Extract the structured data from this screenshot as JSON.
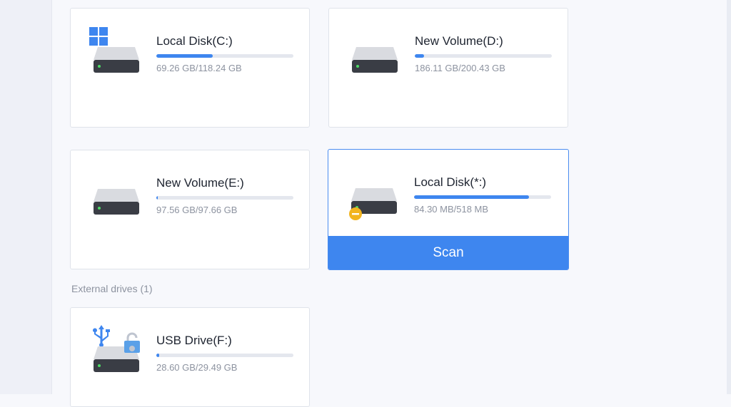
{
  "colors": {
    "accent": "#3e86ef",
    "warning": "#f2b41f"
  },
  "drives": [
    {
      "name": "Local Disk(C:)",
      "size": "69.26 GB/118.24 GB",
      "usage_fraction": 0.41,
      "badge_icon": "windows-icon"
    },
    {
      "name": "New Volume(D:)",
      "size": "186.11 GB/200.43 GB",
      "usage_fraction": 0.07,
      "badge_icon": ""
    },
    {
      "name": "New Volume(E:)",
      "size": "97.56 GB/97.66 GB",
      "usage_fraction": 0.01,
      "badge_icon": ""
    },
    {
      "name": "Local Disk(*:)",
      "size": "84.30 MB/518 MB",
      "usage_fraction": 0.84,
      "badge_icon": "warning-icon",
      "selected": true,
      "action_label": "Scan"
    }
  ],
  "external_section": {
    "label": "External drives (1)",
    "drives": [
      {
        "name": "USB Drive(F:)",
        "size": "28.60 GB/29.49 GB",
        "usage_fraction": 0.02,
        "badge_icon": "usb-icon",
        "locked": true
      }
    ]
  }
}
